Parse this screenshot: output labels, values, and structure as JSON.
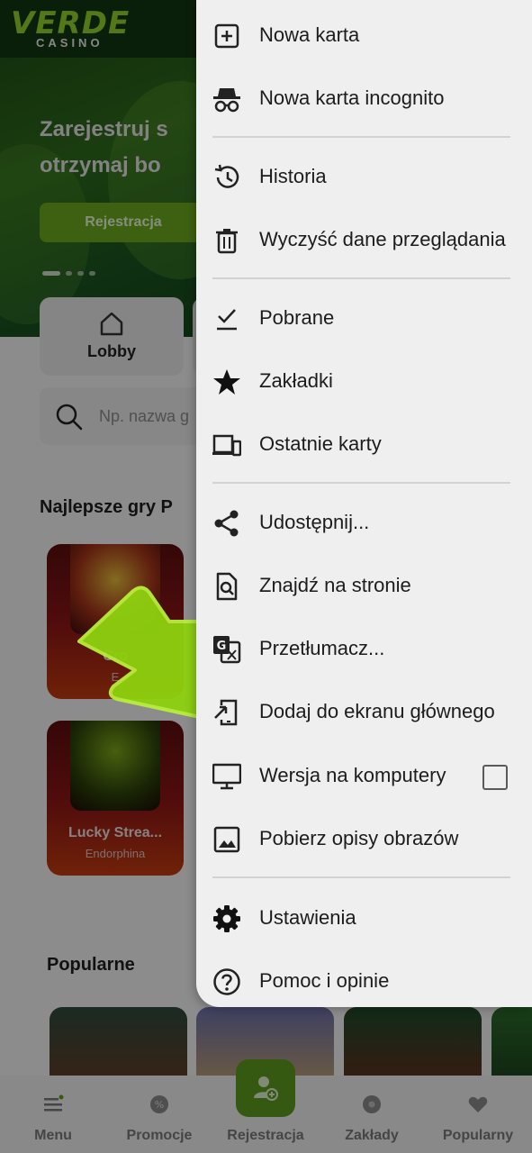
{
  "site": {
    "logo": "VERDE",
    "logo_sub": "CASINO",
    "hero_title": "Zarejestruj s\notrzymaj bo",
    "hero_button": "Rejestracja",
    "lobby_label": "Lobby",
    "search_placeholder": "Np. nazwa g",
    "top_games_title": "Najlepsze gry P",
    "games": [
      {
        "name": "Cro",
        "provider": "E"
      },
      {
        "name": "Lucky Strea...",
        "provider": "Endorphina"
      }
    ],
    "popular_title": "Popularne"
  },
  "bottom_nav": [
    {
      "label": "Menu",
      "icon": "menu-icon"
    },
    {
      "label": "Promocje",
      "icon": "promo-icon"
    },
    {
      "label": "Rejestracja",
      "icon": "add-user-icon"
    },
    {
      "label": "Zakłady",
      "icon": "ball-icon"
    },
    {
      "label": "Popularny",
      "icon": "heart-icon"
    }
  ],
  "menu": {
    "items": [
      {
        "label": "Nowa karta",
        "icon": "new-tab-icon"
      },
      {
        "label": "Nowa karta incognito",
        "icon": "incognito-icon"
      },
      {
        "label": "Historia",
        "icon": "history-icon"
      },
      {
        "label": "Wyczyść dane przeglądania",
        "icon": "trash-icon"
      },
      {
        "label": "Pobrane",
        "icon": "downloads-icon"
      },
      {
        "label": "Zakładki",
        "icon": "star-icon"
      },
      {
        "label": "Ostatnie karty",
        "icon": "devices-icon"
      },
      {
        "label": "Udostępnij...",
        "icon": "share-icon"
      },
      {
        "label": "Znajdź na stronie",
        "icon": "find-in-page-icon"
      },
      {
        "label": "Przetłumacz...",
        "icon": "translate-icon"
      },
      {
        "label": "Dodaj do ekranu głównego",
        "icon": "add-to-home-icon"
      },
      {
        "label": "Wersja na komputery",
        "icon": "desktop-icon",
        "checked": false
      },
      {
        "label": "Pobierz opisy obrazów",
        "icon": "image-icon"
      },
      {
        "label": "Ustawienia",
        "icon": "settings-icon"
      },
      {
        "label": "Pomoc i opinie",
        "icon": "help-icon"
      }
    ]
  },
  "colors": {
    "brand_green": "#8fcf2a",
    "arrow_green": "#8ed10f",
    "menu_bg": "#efefef"
  }
}
